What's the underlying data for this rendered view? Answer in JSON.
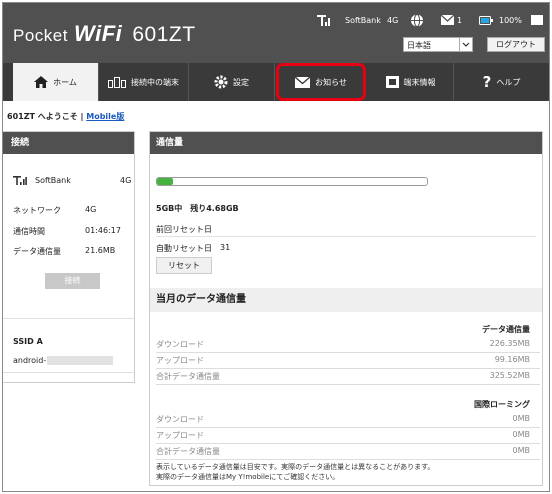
{
  "header": {
    "logo_pocket": "Pocket",
    "logo_wifi": "WiFi",
    "logo_model": "601ZT",
    "carrier": "SoftBank",
    "network": "4G",
    "mail_count": "1",
    "battery": "100%",
    "language": "日本語",
    "logout_label": "ログアウト"
  },
  "nav": {
    "tabs": [
      {
        "label": "ホーム",
        "icon": "home-icon"
      },
      {
        "label": "接続中の端末",
        "icon": "devices-icon"
      },
      {
        "label": "設定",
        "icon": "gear-icon"
      },
      {
        "label": "お知らせ",
        "icon": "mail-icon"
      },
      {
        "label": "端末情報",
        "icon": "info-icon"
      },
      {
        "label": "ヘルプ",
        "icon": "help-icon"
      }
    ]
  },
  "welcome": {
    "text": "601ZT へようこそ |",
    "mobile_link": "Mobile版"
  },
  "connection": {
    "title": "接続",
    "carrier": "SoftBank",
    "carrier_net": "4G",
    "rows": [
      {
        "label": "ネットワーク",
        "value": "4G"
      },
      {
        "label": "通信時間",
        "value": "01:46:17"
      },
      {
        "label": "データ通信量",
        "value": "21.6MB"
      }
    ],
    "connect_label": "接続",
    "ssid_label": "SSID A",
    "ssid_value": "android-"
  },
  "usage": {
    "title": "通信量",
    "progress_fraction": 0.06,
    "summary": "5GB中　残り4.68GB",
    "last_reset_label": "前回リセット日",
    "auto_reset_label": "自動リセット日",
    "auto_reset_value": "31",
    "reset_label": "リセット",
    "monthly_title": "当月のデータ通信量",
    "data_header": "データ通信量",
    "data_rows": [
      {
        "label": "ダウンロード",
        "value": "226.35MB"
      },
      {
        "label": "アップロード",
        "value": "99.16MB"
      },
      {
        "label": "合計データ通信量",
        "value": "325.52MB"
      }
    ],
    "roaming_header": "国際ローミング",
    "roaming_rows": [
      {
        "label": "ダウンロード",
        "value": "0MB"
      },
      {
        "label": "アップロード",
        "value": "0MB"
      },
      {
        "label": "合計データ通信量",
        "value": "0MB"
      }
    ],
    "note1": "表示しているデータ通信量は目安です。実際のデータ通信量とは異なることがあります。",
    "note2": "実際のデータ通信量はMy Y!mobileにてご確認ください。"
  },
  "colors": {
    "header_bg": "#505050",
    "nav_bg": "#3a3a3a",
    "highlight": "#e60012",
    "progress": "#45b33d",
    "link": "#1a5bbf"
  }
}
